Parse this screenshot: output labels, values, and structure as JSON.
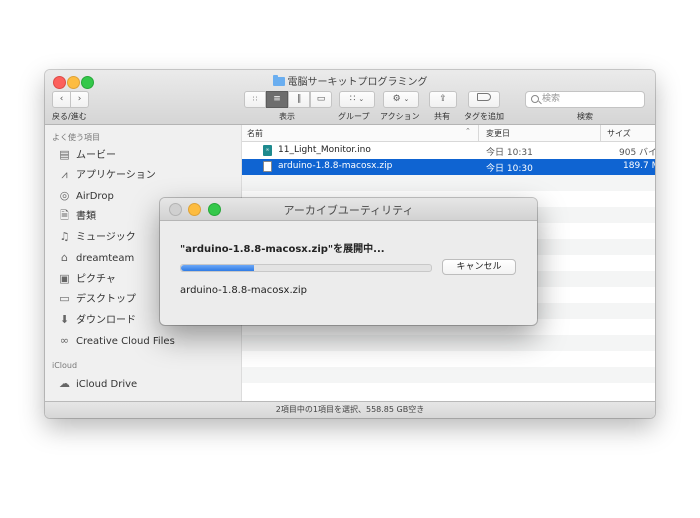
{
  "window": {
    "title": "電脳サーキットプログラミング",
    "toolbar": {
      "nav_label": "戻る/進む",
      "view_label": "表示",
      "group_label": "グループ",
      "action_label": "アクション",
      "share_label": "共有",
      "tag_label": "タグを追加",
      "search_label": "検索",
      "search_placeholder": "検索"
    },
    "sidebar": {
      "favorites_heading": "よく使う項目",
      "items": [
        {
          "label": "ムービー",
          "icon": "film-icon"
        },
        {
          "label": "アプリケーション",
          "icon": "applications-icon"
        },
        {
          "label": "AirDrop",
          "icon": "airdrop-icon"
        },
        {
          "label": "書類",
          "icon": "documents-icon"
        },
        {
          "label": "ミュージック",
          "icon": "music-note-icon"
        },
        {
          "label": "dreamteam",
          "icon": "home-icon"
        },
        {
          "label": "ピクチャ",
          "icon": "camera-icon"
        },
        {
          "label": "デスクトップ",
          "icon": "desktop-icon"
        },
        {
          "label": "ダウンロード",
          "icon": "download-icon"
        },
        {
          "label": "Creative Cloud Files",
          "icon": "creative-cloud-icon"
        }
      ],
      "icloud_heading": "iCloud",
      "icloud_items": [
        {
          "label": "iCloud Drive",
          "icon": "cloud-icon"
        }
      ]
    },
    "file_list": {
      "columns": {
        "name": "名前",
        "modified": "変更日",
        "size": "サイズ"
      },
      "rows": [
        {
          "name": "11_Light_Monitor.ino",
          "modified": "今日 10:31",
          "size": "905 バイ",
          "selected": false
        },
        {
          "name": "arduino-1.8.8-macosx.zip",
          "modified": "今日 10:30",
          "size": "189.7 M",
          "selected": true
        }
      ]
    },
    "status_text": "2項目中の1項目を選択、558.85 GB空き"
  },
  "dialog": {
    "title": "アーカイブユーティリティ",
    "message": "\"arduino-1.8.8-macosx.zip\"を展開中...",
    "progress": 0.29,
    "cancel_label": "キャンセル",
    "filename": "arduino-1.8.8-macosx.zip"
  },
  "colors": {
    "selection": "#0f64d2",
    "progress": "#2f7be5"
  }
}
